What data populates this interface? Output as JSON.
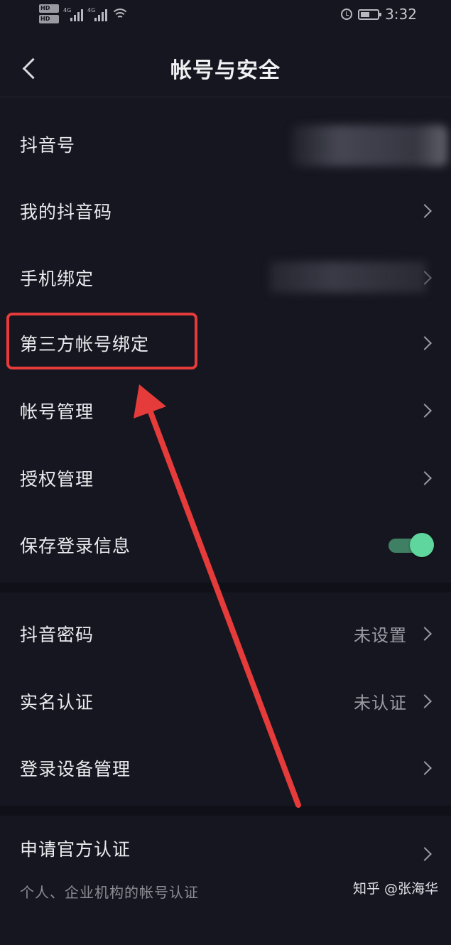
{
  "status_bar": {
    "time": "3:32",
    "sim1": "HD",
    "sim2": "HD",
    "network": "4G"
  },
  "nav": {
    "title": "帐号与安全"
  },
  "settings": {
    "douyin_id_label": "抖音号",
    "my_qr_label": "我的抖音码",
    "phone_binding_label": "手机绑定",
    "third_party_label": "第三方帐号绑定",
    "account_mgmt_label": "帐号管理",
    "auth_mgmt_label": "授权管理",
    "save_login_label": "保存登录信息",
    "save_login_enabled": true,
    "password_label": "抖音密码",
    "password_value": "未设置",
    "realname_label": "实名认证",
    "realname_value": "未认证",
    "device_mgmt_label": "登录设备管理",
    "official_label": "申请官方认证",
    "official_sub": "个人、企业机构的帐号认证"
  },
  "watermark": "知乎 @张海华",
  "colors": {
    "background": "#15161f",
    "toggle_on": "#5ed69d",
    "annotation": "#e63b3b"
  }
}
